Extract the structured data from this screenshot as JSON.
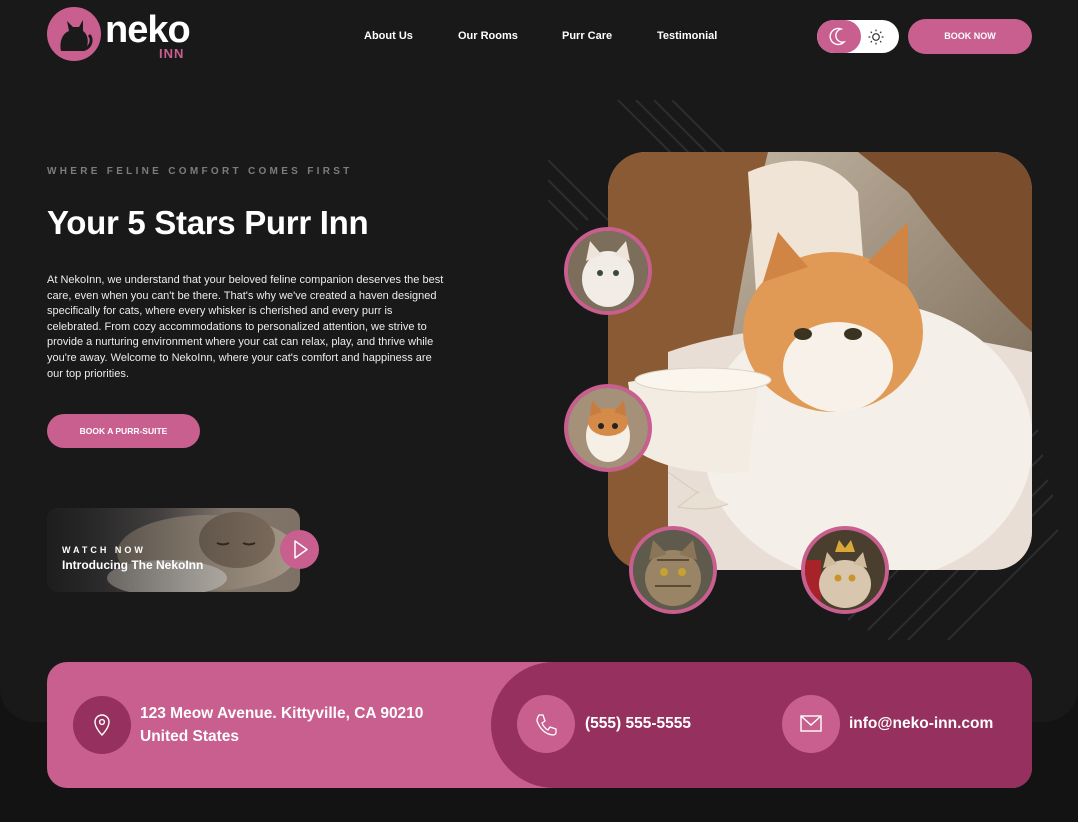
{
  "brand": {
    "name": "neko",
    "sub": "INN"
  },
  "nav": {
    "items": [
      "About Us",
      "Our Rooms",
      "Purr Care",
      "Testimonial"
    ]
  },
  "header": {
    "book_now": "BOOK NOW",
    "theme_toggle": {
      "modes": [
        "dark",
        "light"
      ],
      "active": "dark"
    }
  },
  "hero": {
    "eyebrow": "WHERE FELINE COMFORT COMES FIRST",
    "title": "Your 5 Stars Purr Inn",
    "description": "At NekoInn, we understand that your beloved feline companion deserves the best care, even when you can't be there. That's why we've created a haven designed specifically for cats, where every whisker is cherished and every purr is celebrated. From cozy accommodations to personalized attention, we strive to provide a nurturing environment where your cat can relax, play, and thrive while you're away. Welcome to NekoInn, where your cat's comfort and happiness are our top priorities.",
    "cta": "BOOK A PURR-SUITE"
  },
  "video": {
    "label": "WATCH NOW",
    "title": "Introducing The NekoInn"
  },
  "contact": {
    "address_line1": "123 Meow Avenue. Kittyville, CA 90210",
    "address_line2": "United States",
    "phone": "(555) 555-5555",
    "email": "info@neko-inn.com"
  },
  "colors": {
    "accent": "#c85f8f",
    "accent_dark": "#96305f",
    "background": "#19191a"
  }
}
